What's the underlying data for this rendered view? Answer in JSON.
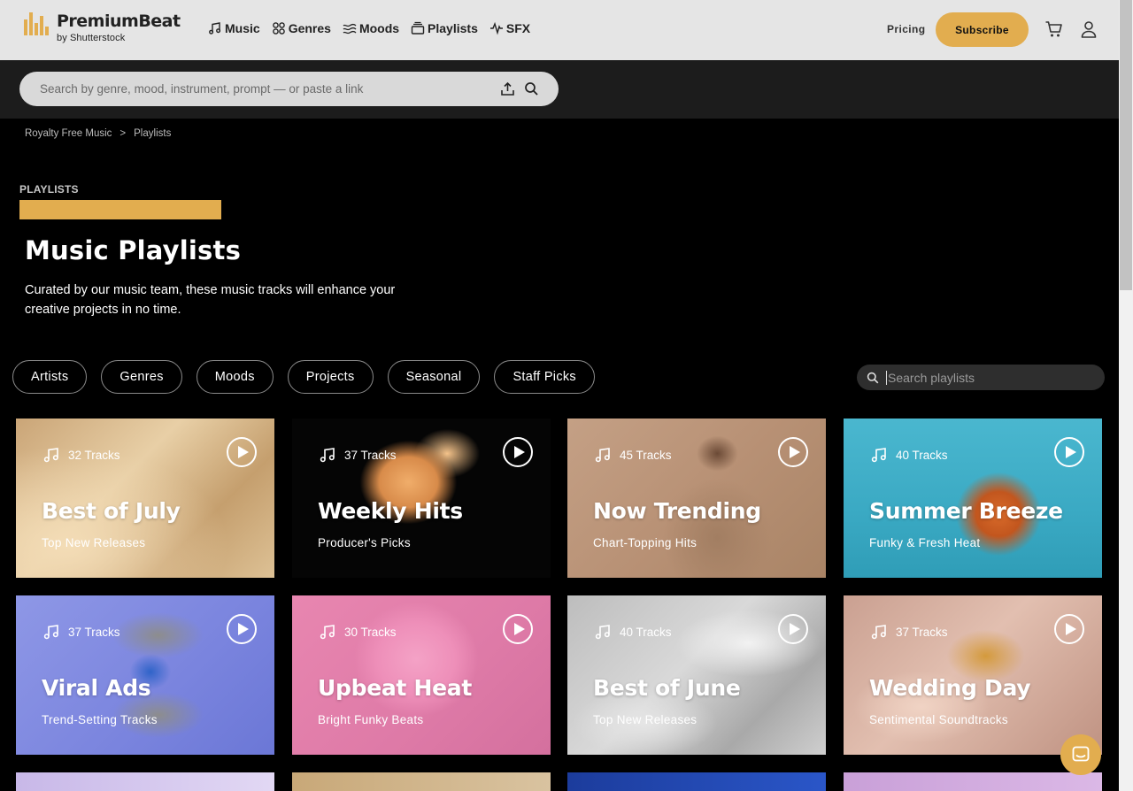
{
  "header": {
    "logo_title": "PremiumBeat",
    "logo_sub": "by Shutterstock",
    "nav": [
      {
        "label": "Music",
        "icon": "music-note-icon"
      },
      {
        "label": "Genres",
        "icon": "genres-icon"
      },
      {
        "label": "Moods",
        "icon": "moods-wave-icon"
      },
      {
        "label": "Playlists",
        "icon": "playlists-icon"
      },
      {
        "label": "SFX",
        "icon": "sfx-waveform-icon"
      }
    ],
    "pricing": "Pricing",
    "subscribe": "Subscribe"
  },
  "search": {
    "placeholder": "Search by genre, mood, instrument, prompt — or paste a link"
  },
  "breadcrumb": {
    "root": "Royalty Free Music",
    "separator": ">",
    "current": "Playlists"
  },
  "hero": {
    "eyebrow": "PLAYLISTS",
    "title": "Music Playlists",
    "description": "Curated by our music team, these music tracks will enhance your creative projects in no time."
  },
  "filters": {
    "chips": [
      "Artists",
      "Genres",
      "Moods",
      "Projects",
      "Seasonal",
      "Staff Picks"
    ],
    "search_placeholder": "Search playlists"
  },
  "playlists": [
    {
      "tracks": "32 Tracks",
      "title": "Best of July",
      "subtitle": "Top New Releases"
    },
    {
      "tracks": "37 Tracks",
      "title": "Weekly Hits",
      "subtitle": "Producer's Picks"
    },
    {
      "tracks": "45 Tracks",
      "title": "Now Trending",
      "subtitle": "Chart-Topping Hits"
    },
    {
      "tracks": "40 Tracks",
      "title": "Summer Breeze",
      "subtitle": "Funky & Fresh Heat"
    },
    {
      "tracks": "37 Tracks",
      "title": "Viral Ads",
      "subtitle": "Trend-Setting Tracks"
    },
    {
      "tracks": "30 Tracks",
      "title": "Upbeat Heat",
      "subtitle": "Bright Funky Beats"
    },
    {
      "tracks": "40 Tracks",
      "title": "Best of June",
      "subtitle": "Top New Releases"
    },
    {
      "tracks": "37 Tracks",
      "title": "Wedding Day",
      "subtitle": "Sentimental Soundtracks"
    }
  ],
  "colors": {
    "accent": "#e2ad4f",
    "header_bg": "#e5e5e5",
    "search_band_bg": "#1c1c1c",
    "page_bg": "#000000"
  }
}
